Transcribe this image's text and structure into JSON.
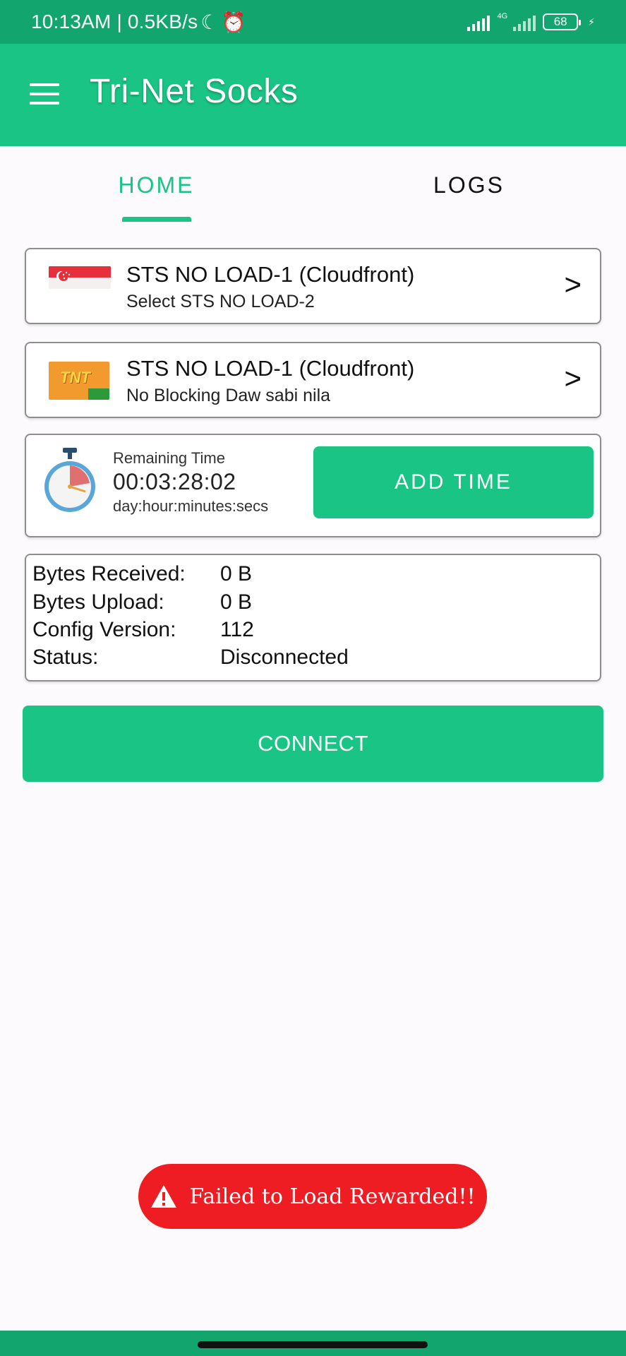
{
  "status_bar": {
    "time": "10:13AM | 0.5KB/s",
    "network_type": "4G",
    "battery": "68"
  },
  "app_bar": {
    "title": "Tri-Net Socks"
  },
  "tabs": [
    {
      "label": "HOME",
      "active": true
    },
    {
      "label": "LOGS",
      "active": false
    }
  ],
  "servers": [
    {
      "title": "STS NO LOAD-1 (Cloudfront)",
      "subtitle": "Select STS NO LOAD-2",
      "icon": "singapore-flag"
    },
    {
      "title": "STS NO LOAD-1 (Cloudfront)",
      "subtitle": "No Blocking Daw sabi nila",
      "icon": "tnt-logo"
    }
  ],
  "timer": {
    "label": "Remaining Time",
    "value": "00:03:28:02",
    "format": "day:hour:minutes:secs",
    "add_time_label": "ADD TIME"
  },
  "stats": [
    {
      "label": "Bytes Received:",
      "value": "0 B"
    },
    {
      "label": "Bytes Upload:",
      "value": "0 B"
    },
    {
      "label": "Config Version:",
      "value": "112"
    },
    {
      "label": "Status:",
      "value": "Disconnected"
    }
  ],
  "connect_label": "CONNECT",
  "toast": {
    "message": "Failed to Load Rewarded!!"
  },
  "colors": {
    "primary": "#1ac484",
    "status_bar": "#12a56e",
    "toast": "#ee1d23"
  }
}
